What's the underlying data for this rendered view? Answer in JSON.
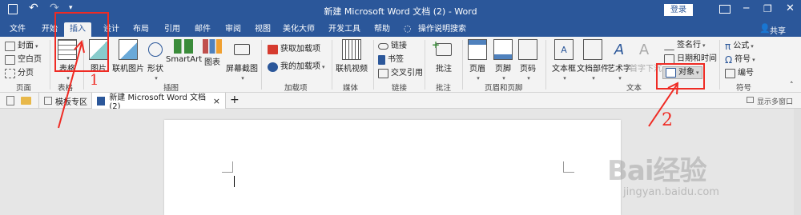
{
  "title_bar": {
    "title": "新建 Microsoft Word 文档 (2) - Word",
    "login": "登录"
  },
  "tabs": [
    "文件",
    "开始",
    "插入",
    "设计",
    "布局",
    "引用",
    "邮件",
    "审阅",
    "视图",
    "美化大师",
    "开发工具",
    "帮助",
    "操作说明搜索"
  ],
  "share": "共享",
  "ribbon": {
    "pages": {
      "items": [
        "封面",
        "空白页",
        "分页"
      ],
      "label": "页面"
    },
    "table": {
      "btn": "表格",
      "label": "表格"
    },
    "illustrations": {
      "items": [
        "图片",
        "联机图片",
        "形状",
        "SmartArt",
        "图表",
        "屏幕截图"
      ],
      "label": "插图"
    },
    "addins": {
      "items": [
        "获取加载项",
        "我的加载项"
      ],
      "label": "加载项"
    },
    "media": {
      "btn": "联机视频",
      "label": "媒体"
    },
    "links": {
      "items": [
        "链接",
        "书签",
        "交叉引用"
      ],
      "label": "链接"
    },
    "comments": {
      "btn": "批注",
      "label": "批注"
    },
    "header_footer": {
      "items": [
        "页眉",
        "页脚",
        "页码"
      ],
      "label": "页眉和页脚"
    },
    "text": {
      "items": [
        "文本框",
        "文档部件",
        "艺术字",
        "首字下沉"
      ],
      "right_items": [
        "签名行",
        "日期和时间",
        "对象"
      ],
      "label": "文本"
    },
    "symbols": {
      "items": [
        "公式",
        "符号",
        "编号"
      ],
      "label": "符号"
    }
  },
  "doc_tabs": {
    "template": "模板专区",
    "doc": "新建 Microsoft Word 文档 (2)",
    "close": "×",
    "add": "+",
    "multi": "显示多窗口"
  },
  "annotations": {
    "one": "1",
    "two": "2"
  },
  "watermark": {
    "main": "Bai经验",
    "sub": "jingyan.baidu.com"
  }
}
